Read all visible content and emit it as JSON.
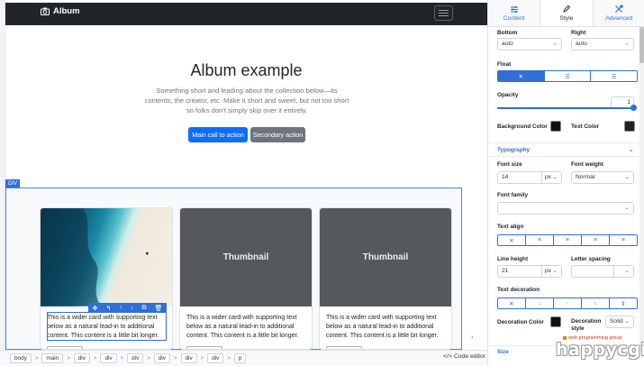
{
  "navbar": {
    "brand": "Album"
  },
  "hero": {
    "title": "Album example",
    "lead": "Something short and leading about the collection below—its contents, the creator, etc. Make it short and sweet, but not too short so folks don't simply skip over it entirely.",
    "primary_button": "Main call to action",
    "secondary_button": "Secondary action"
  },
  "selection": {
    "label": "DIV"
  },
  "cards": [
    {
      "thumb": "",
      "text": "This is a wider card with supporting text below as a natural lead-in to additional content. This content is a little bit longer."
    },
    {
      "thumb": "Thumbnail",
      "text": "This is a wider card with supporting text below as a natural lead-in to additional content. This content is a little bit longer."
    },
    {
      "thumb": "Thumbnail",
      "text": "This is a wider card with supporting text below as a natural lead-in to additional content. This content is a little bit longer."
    }
  ],
  "breadcrumb": [
    "body",
    "main",
    "div",
    "div",
    "div",
    "div",
    "div",
    "div",
    "p"
  ],
  "code_editor": "Code editor",
  "panel": {
    "tabs": [
      "Content",
      "Style",
      "Advanced"
    ],
    "active_tab": "Style",
    "bottom": {
      "label": "Bottom",
      "value": "auto"
    },
    "right": {
      "label": "Right",
      "value": "auto"
    },
    "float_label": "Float",
    "opacity": {
      "label": "Opacity",
      "value": "1"
    },
    "background_color": {
      "label": "Background Color",
      "value": "#111111"
    },
    "text_color": {
      "label": "Text Color",
      "value": "#222222"
    },
    "typography_header": "Typography",
    "font_size": {
      "label": "Font size",
      "value": "14",
      "unit": "px"
    },
    "font_weight": {
      "label": "Font weight",
      "value": "Normal"
    },
    "font_family_label": "Font family",
    "text_align_label": "Text align",
    "line_height": {
      "label": "Line height",
      "value": "21",
      "unit": "px"
    },
    "letter_spacing_label": "Letter spacing",
    "text_decoration_label": "Text decoration",
    "decoration_color": {
      "label": "Decoration Color",
      "value": "#111111"
    },
    "decoration_style": {
      "label": "Decoration style",
      "value": "Solid"
    },
    "size_header": "Size"
  },
  "watermark": {
    "small": "web programming group",
    "big": "happycgi"
  },
  "colors": {
    "accent": "#2f6fd6",
    "primary": "#0d6efd",
    "secondary": "#6c757d",
    "navbar": "#212529",
    "thumbnail": "#55595c"
  }
}
